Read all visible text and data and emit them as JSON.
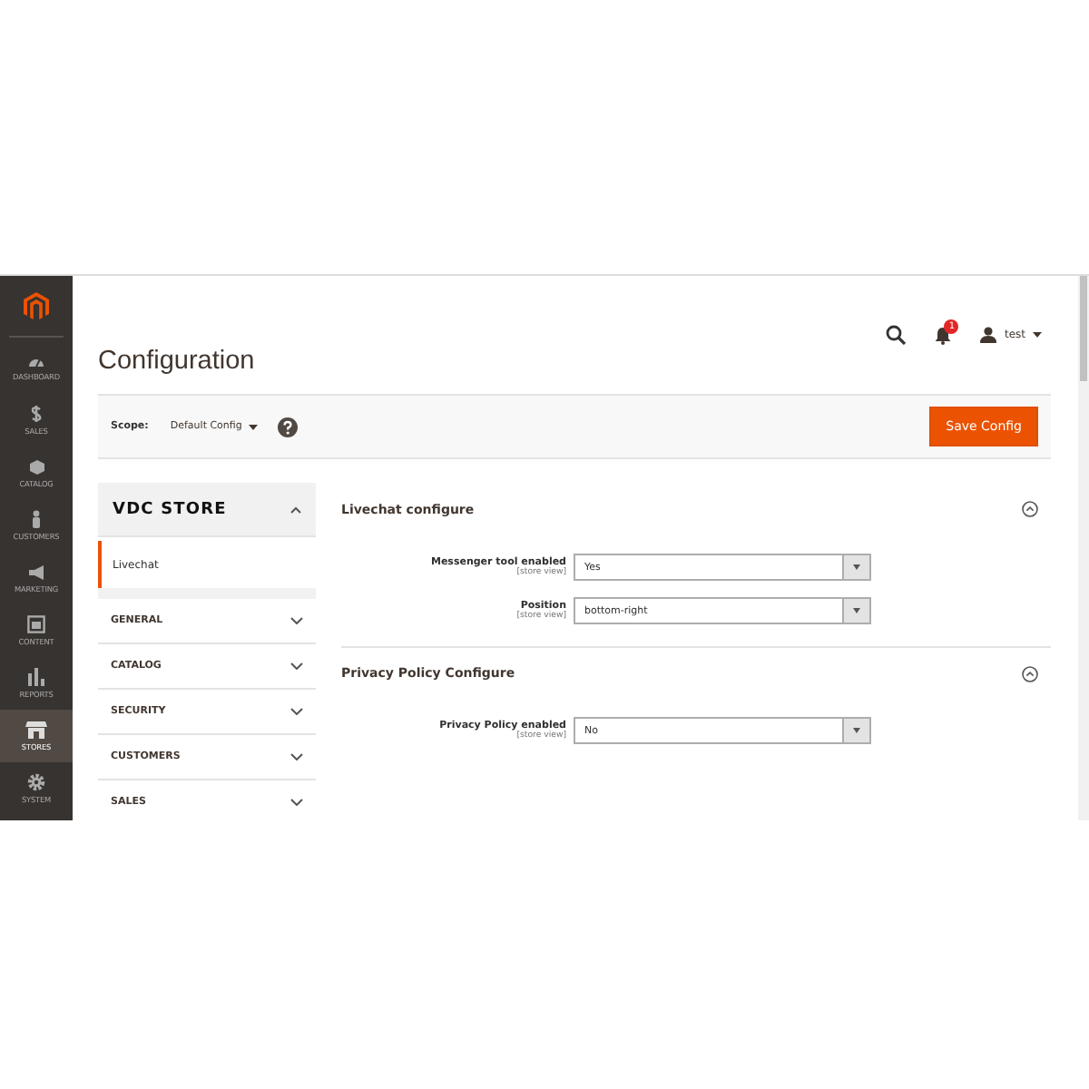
{
  "nav": [
    {
      "label": "DASHBOARD",
      "kind": "gauge",
      "selected": false
    },
    {
      "label": "SALES",
      "kind": "dollar",
      "selected": false
    },
    {
      "label": "CATALOG",
      "kind": "box",
      "selected": false
    },
    {
      "label": "CUSTOMERS",
      "kind": "person",
      "selected": false
    },
    {
      "label": "MARKETING",
      "kind": "megaphone",
      "selected": false
    },
    {
      "label": "CONTENT",
      "kind": "layout",
      "selected": false
    },
    {
      "label": "REPORTS",
      "kind": "bars",
      "selected": false
    },
    {
      "label": "STORES",
      "kind": "store",
      "selected": true
    },
    {
      "label": "SYSTEM",
      "kind": "gear",
      "selected": false
    }
  ],
  "page_title": "Configuration",
  "header": {
    "notifications": "1",
    "user": "test"
  },
  "scope": {
    "label": "Scope:",
    "value": "Default Config"
  },
  "save_button": "Save Config",
  "config_tabs": [
    {
      "title": "VDC STORE",
      "expanded": true,
      "items": [
        {
          "label": "Livechat",
          "selected": true
        }
      ]
    },
    {
      "title": "GENERAL",
      "expanded": false
    },
    {
      "title": "CATALOG",
      "expanded": false
    },
    {
      "title": "SECURITY",
      "expanded": false
    },
    {
      "title": "CUSTOMERS",
      "expanded": false
    },
    {
      "title": "SALES",
      "expanded": false
    }
  ],
  "sections": [
    {
      "title": "Livechat configure",
      "fields": [
        {
          "label": "Messenger tool enabled",
          "scope": "[store view]",
          "value": "Yes"
        },
        {
          "label": "Position",
          "scope": "[store view]",
          "value": "bottom-right"
        }
      ]
    },
    {
      "title": "Privacy Policy Configure",
      "fields": [
        {
          "label": "Privacy Policy enabled",
          "scope": "[store view]",
          "value": "No"
        }
      ]
    }
  ]
}
